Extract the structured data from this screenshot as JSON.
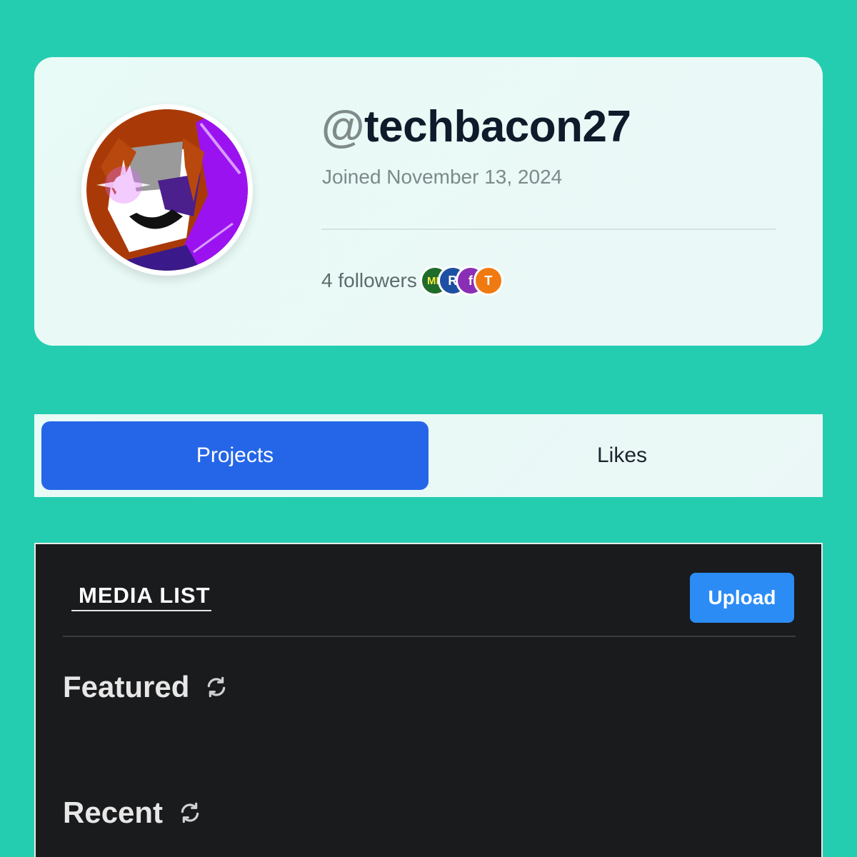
{
  "profile": {
    "username_at": "@",
    "username": "techbacon27",
    "joined": "Joined November 13, 2024",
    "followers_text": "4 followers",
    "follower_avatars": [
      {
        "letter": "ML",
        "color": "#1f6b2b"
      },
      {
        "letter": "R",
        "color": "#1d4fa3"
      },
      {
        "letter": "f",
        "color": "#8a2fb5"
      },
      {
        "letter": "T",
        "color": "#f07a12"
      }
    ]
  },
  "tabs": {
    "projects": "Projects",
    "likes": "Likes"
  },
  "media": {
    "title": "MEDIA LIST",
    "upload_label": "Upload",
    "featured_label": "Featured",
    "recent_label": "Recent"
  },
  "colors": {
    "background": "#25cdb0",
    "active_tab": "#2566e8",
    "upload_button": "#2b8cf6",
    "panel_dark": "#1a1b1d"
  }
}
